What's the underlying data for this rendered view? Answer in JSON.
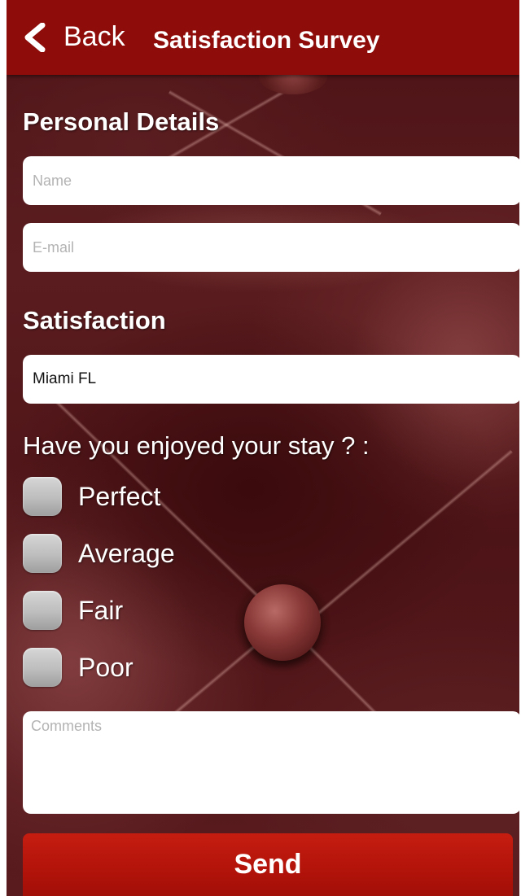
{
  "header": {
    "back_label": "Back",
    "title": "Satisfaction Survey",
    "background_color": "#8e0d0b",
    "back_icon": "chevron-left-icon"
  },
  "personal_details": {
    "title": "Personal Details",
    "name_placeholder": "Name",
    "email_placeholder": "E-mail"
  },
  "satisfaction": {
    "title": "Satisfaction",
    "location_value": "Miami FL"
  },
  "question": {
    "text": "Have you enjoyed your stay ? :",
    "options": [
      {
        "label": "Perfect",
        "checked": false
      },
      {
        "label": "Average",
        "checked": false
      },
      {
        "label": "Fair",
        "checked": false
      },
      {
        "label": "Poor",
        "checked": false
      }
    ]
  },
  "comments": {
    "placeholder": "Comments"
  },
  "send_button": {
    "label": "Send",
    "color": "#b2130a"
  }
}
